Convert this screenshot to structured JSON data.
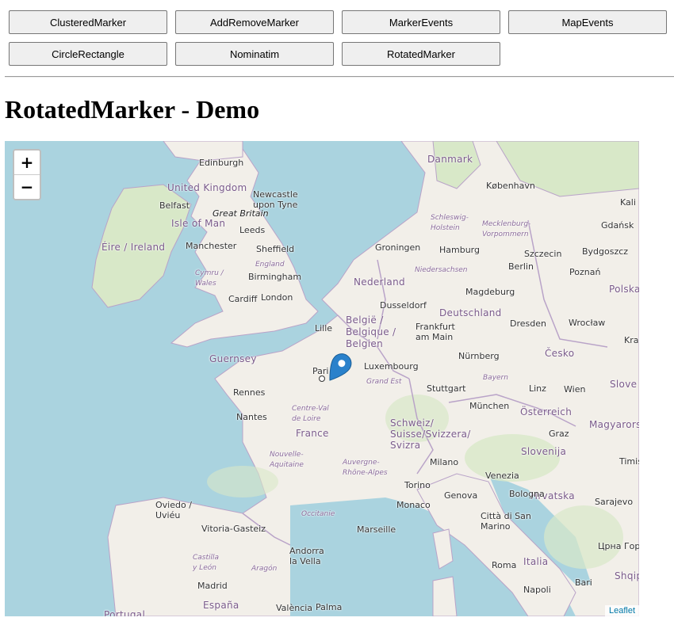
{
  "nav": {
    "buttons": [
      "ClusteredMarker",
      "AddRemoveMarker",
      "MarkerEvents",
      "MapEvents",
      "CircleRectangle",
      "Nominatim",
      "RotatedMarker"
    ]
  },
  "page": {
    "title": "RotatedMarker - Demo"
  },
  "map": {
    "zoom_in": "+",
    "zoom_out": "−",
    "attribution": "Leaflet",
    "colors": {
      "water": "#aad3df",
      "land": "#f2efe9",
      "green": "#d8e8c8",
      "border": "#b9a3c8",
      "marker": "#2a81cb"
    },
    "marker": {
      "type": "map-marker-icon",
      "rotated": true
    },
    "labels": {
      "edinburgh": "Edinburgh",
      "united_kingdom": "United Kingdom",
      "newcastle": "Newcastle\nupon Tyne",
      "belfast": "Belfast",
      "great_britain": "Great Britain",
      "isle_of_man": "Isle of Man",
      "leeds": "Leeds",
      "eire": "Éire / Ireland",
      "manchester": "Manchester",
      "sheffield": "Sheffield",
      "england": "England",
      "cymru": "Cymru /\nWales",
      "birmingham": "Birmingham",
      "cardiff": "Cardiff",
      "london": "London",
      "guernsey": "Guernsey",
      "danmark": "Danmark",
      "kobenhavn": "København",
      "schleswig": "Schleswig-\nHolstein",
      "mecklenburg": "Mecklenburg-\nVorpommern",
      "kali": "Kali",
      "gdansk": "Gdańsk",
      "groningen": "Groningen",
      "hamburg": "Hamburg",
      "szczecin": "Szczecin",
      "bydgoszcz": "Bydgoszcz",
      "niedersachsen": "Niedersachsen",
      "nederland": "Nederland",
      "berlin": "Berlin",
      "poznan": "Poznań",
      "polska": "Polska",
      "dusseldorf": "Dusseldorf",
      "magdeburg": "Magdeburg",
      "lille": "Lille",
      "belgie": "België /\nBelgique /\nBelgien",
      "deutschland": "Deutschland",
      "frankfurt": "Frankfurt\nam Main",
      "dresden": "Dresden",
      "wroclaw": "Wrocław",
      "kra": "Kra",
      "luxembourg": "Luxembourg",
      "paris": "Pari",
      "nurnberg": "Nürnberg",
      "cesko": "Česko",
      "grand_est": "Grand Est",
      "bayern": "Bayern",
      "rennes": "Rennes",
      "stuttgart": "Stuttgart",
      "linz": "Linz",
      "wien": "Wien",
      "slove": "Slove",
      "centre": "Centre-Val\nde Loire",
      "munchen": "München",
      "osterreich": "Österreich",
      "nantes": "Nantes",
      "schweiz": "Schweiz/\nSuisse/Svizzera/\nSvizra",
      "magyarors": "Magyarors",
      "france": "France",
      "graz": "Graz",
      "slovenija": "Slovenija",
      "nouvelle": "Nouvelle-\nAquitaine",
      "auvergne": "Auvergne-\nRhône-Alpes",
      "milano": "Milano",
      "timis": "Timiș",
      "venezia": "Venezia",
      "oviedo": "Oviedo /\nUviéu",
      "torino": "Torino",
      "hrvatska": "Hrvatska",
      "monaco": "Monaco",
      "genova": "Genova",
      "bologna": "Bologna",
      "sarajevo": "Sarajevo",
      "occitanie": "Occitanie",
      "vitoria": "Vitoria-Gasteiz",
      "marseille": "Marseille",
      "citta": "Città di San\nMarino",
      "crna": "Црна Гор",
      "andorra": "Andorra\nla Vella",
      "castilla": "Castilla\ny León",
      "aragon": "Aragón",
      "roma": "Roma",
      "italia": "Italia",
      "madrid": "Madrid",
      "bari": "Bari",
      "shqip": "Shqip",
      "napoli": "Napoli",
      "espana": "España",
      "valencia": "València",
      "palma": "Palma",
      "portugal": "Portugal"
    }
  }
}
